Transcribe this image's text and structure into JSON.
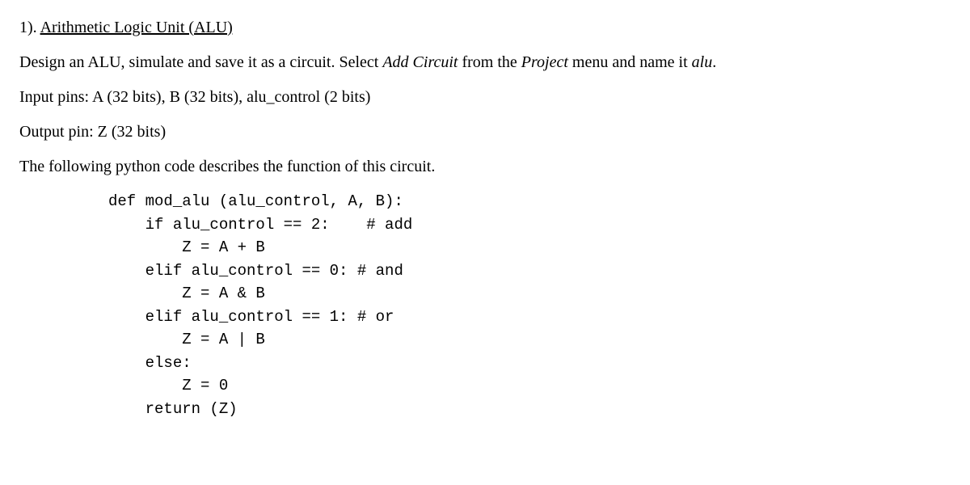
{
  "heading": {
    "number": "1). ",
    "title": "Arithmetic Logic Unit (ALU)"
  },
  "para1": {
    "pre": "Design an ALU, simulate and save it as a circuit.  Select ",
    "italic1": "Add Circuit",
    "mid": " from the ",
    "italic2": "Project",
    "post": " menu and name it ",
    "italic3": "alu",
    "end": "."
  },
  "para2": "Input pins: A (32 bits), B (32 bits), alu_control (2 bits)",
  "para3": "Output pin: Z (32 bits)",
  "para4": "The following python code describes the function of this circuit.",
  "code": {
    "l1": "def mod_alu (alu_control, A, B):",
    "l2": "    if alu_control == 2:    # add",
    "l3": "        Z = A + B",
    "l4": "    elif alu_control == 0: # and",
    "l5": "        Z = A & B",
    "l6": "    elif alu_control == 1: # or",
    "l7": "        Z = A | B",
    "l8": "    else:",
    "l9": "        Z = 0",
    "l10": "    return (Z)"
  }
}
